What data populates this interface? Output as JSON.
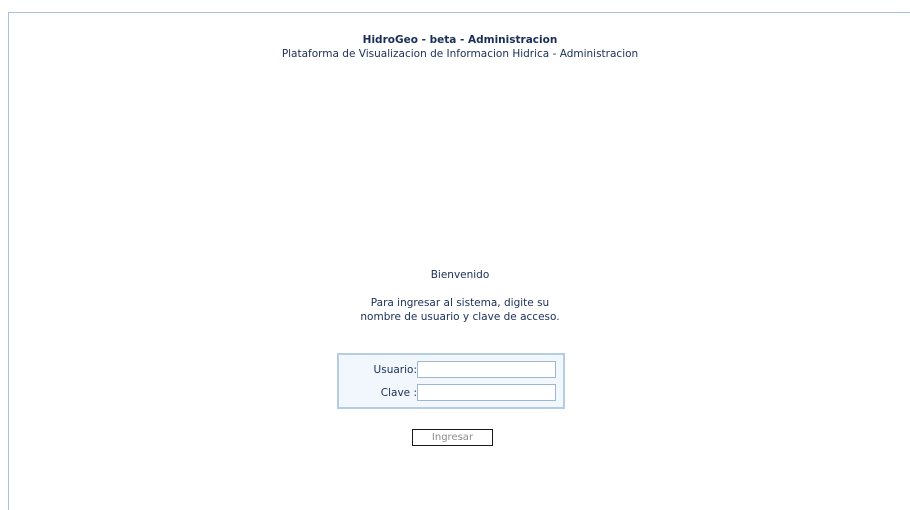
{
  "header": {
    "title": "HidroGeo - beta - Administracion",
    "subtitle": "Plataforma de Visualizacion de Informacion Hidrica - Administracion"
  },
  "welcome": {
    "greeting": "Bienvenido",
    "instructions_line1": "Para ingresar al sistema, digite su",
    "instructions_line2": "nombre de usuario y clave de acceso."
  },
  "login": {
    "username_label": "Usuario:",
    "username_value": "",
    "password_label": "Clave :",
    "password_value": "",
    "submit_label": "Ingresar"
  },
  "colors": {
    "text": "#1a2e57",
    "frame_border": "#a9c3de",
    "login_box_border": "#b4cde5",
    "login_box_background": "#f1f7fd",
    "button_text": "#8c8c8c"
  }
}
